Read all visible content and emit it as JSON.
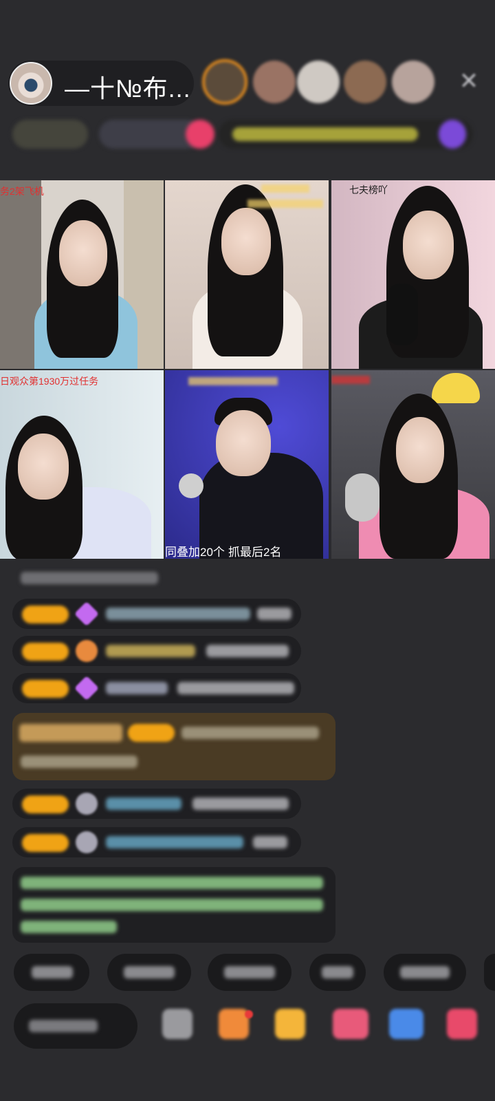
{
  "host": {
    "name": "—十№布..."
  },
  "header": {
    "close_label": "✕",
    "viewer_colors": [
      "#b48a63",
      "#9a7364",
      "#c9c2bc",
      "#8c6a52",
      "#b7a39c"
    ]
  },
  "colors": {
    "background": "#2b2b2e",
    "badge_orange": "#f0a315",
    "caption_red": "#e13030",
    "caption_gold": "#f6d36a",
    "gift_bubble": "#5a4222"
  },
  "grid": {
    "tiles": [
      {
        "top_caption": "务2架飞机",
        "bottom_caption": ""
      },
      {
        "top_caption": "",
        "bottom_caption": ""
      },
      {
        "top_caption": "七夫榜吖",
        "bottom_caption": ""
      },
      {
        "top_caption": "日观众第1930万过任务",
        "bottom_caption": ""
      },
      {
        "top_caption": "",
        "bottom_caption_left": "同叠加20个",
        "bottom_caption_right": "抓最后2名"
      },
      {
        "top_caption": "",
        "bottom_caption": ""
      }
    ]
  }
}
